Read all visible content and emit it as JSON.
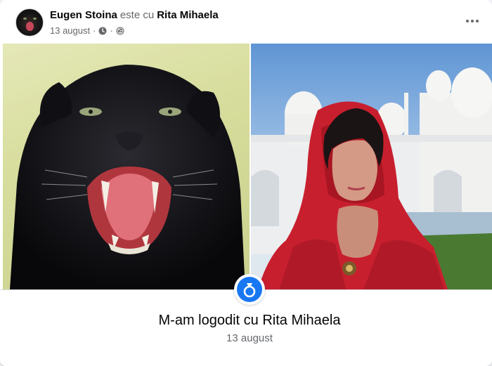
{
  "post": {
    "author": "Eugen Stoina",
    "connector": "este cu",
    "tagged": "Rita Mihaela",
    "date": "13 august",
    "separator": "·",
    "privacy_icon": "globe-icon",
    "time_icon": "clock-icon",
    "more_icon": "more-dots-icon"
  },
  "life_event": {
    "icon": "ring-icon",
    "title": "M-am logodit cu Rita Mihaela",
    "date": "13 august"
  },
  "photos": [
    {
      "subject": "black-panther-photo"
    },
    {
      "subject": "woman-red-veil-mosque-photo"
    }
  ],
  "colors": {
    "accent": "#1877f2",
    "text_primary": "#050505",
    "text_secondary": "#65676b"
  }
}
